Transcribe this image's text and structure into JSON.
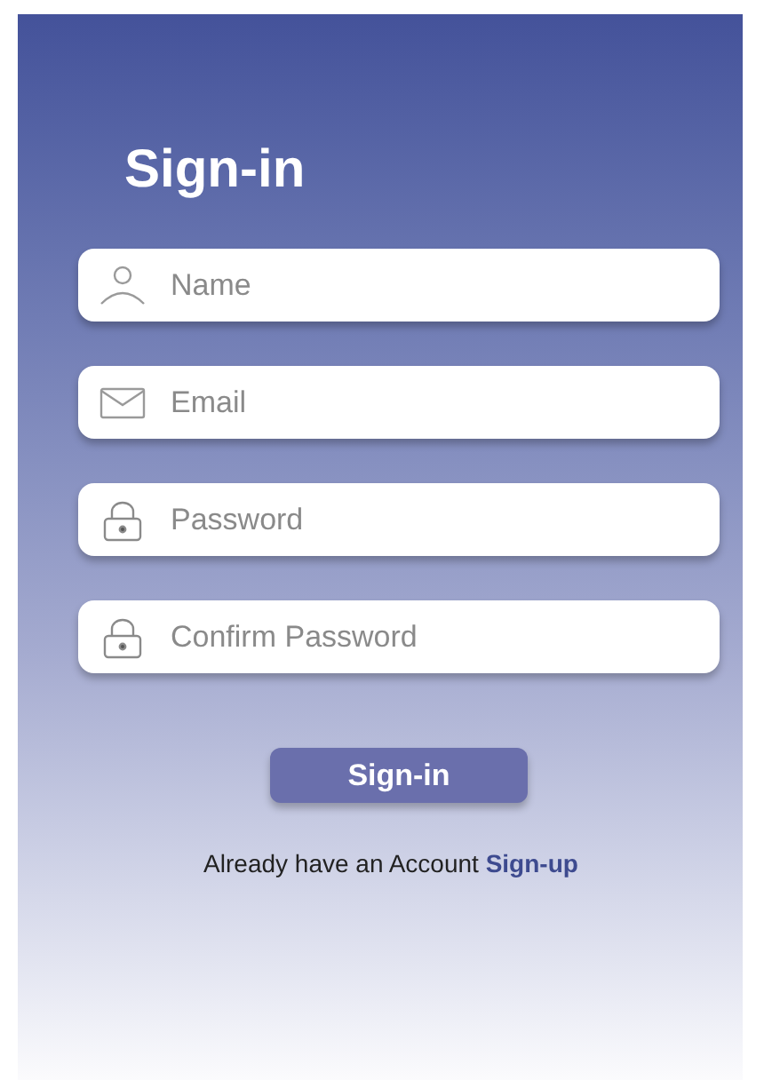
{
  "title": "Sign-in",
  "fields": [
    {
      "kind": "person",
      "placeholder": "Name"
    },
    {
      "kind": "mail",
      "placeholder": "Email"
    },
    {
      "kind": "lock",
      "placeholder": "Password"
    },
    {
      "kind": "lock",
      "placeholder": "Confirm Password"
    }
  ],
  "submit_button": "Sign-in",
  "footer": {
    "text": "Already have an Account",
    "link": "Sign-up"
  }
}
